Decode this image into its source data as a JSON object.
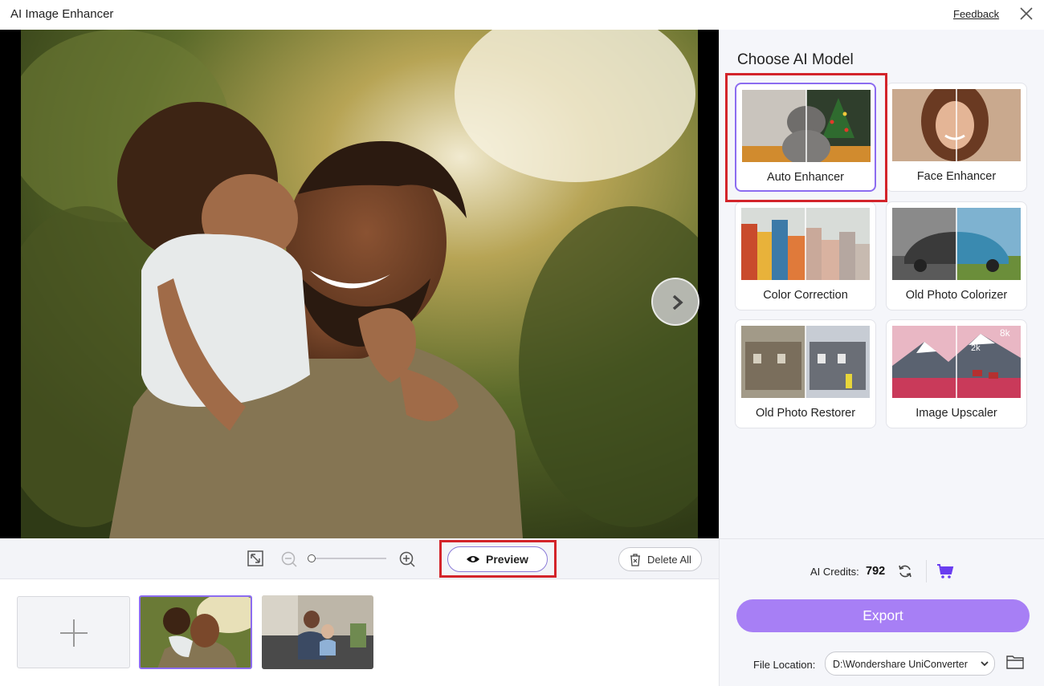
{
  "app": {
    "title": "AI Image Enhancer",
    "feedback_label": "Feedback"
  },
  "toolbar": {
    "preview_label": "Preview",
    "delete_all_label": "Delete All"
  },
  "panel": {
    "title": "Choose AI Model",
    "models": [
      {
        "label": "Auto Enhancer",
        "selected": true
      },
      {
        "label": "Face Enhancer",
        "selected": false
      },
      {
        "label": "Color Correction",
        "selected": false
      },
      {
        "label": "Old Photo Colorizer",
        "selected": false
      },
      {
        "label": "Old Photo Restorer",
        "selected": false
      },
      {
        "label": "Image Upscaler",
        "selected": false
      }
    ],
    "upscale_badges": [
      "8k",
      "2k"
    ],
    "credits_label": "AI Credits:",
    "credits_value": "792",
    "export_label": "Export",
    "file_location_label": "File Location:",
    "file_location_value": "D:\\Wondershare UniConverter"
  },
  "colors": {
    "accent": "#a77ff5",
    "selection_border": "#8c6cf0",
    "highlight_box": "#d3242a"
  },
  "icons": [
    "close-icon",
    "chevron-right-icon",
    "fit-screen-icon",
    "zoom-out-icon",
    "zoom-in-icon",
    "eye-icon",
    "trash-icon",
    "plus-icon",
    "refresh-icon",
    "cart-icon",
    "chevron-down-icon",
    "folder-icon"
  ]
}
